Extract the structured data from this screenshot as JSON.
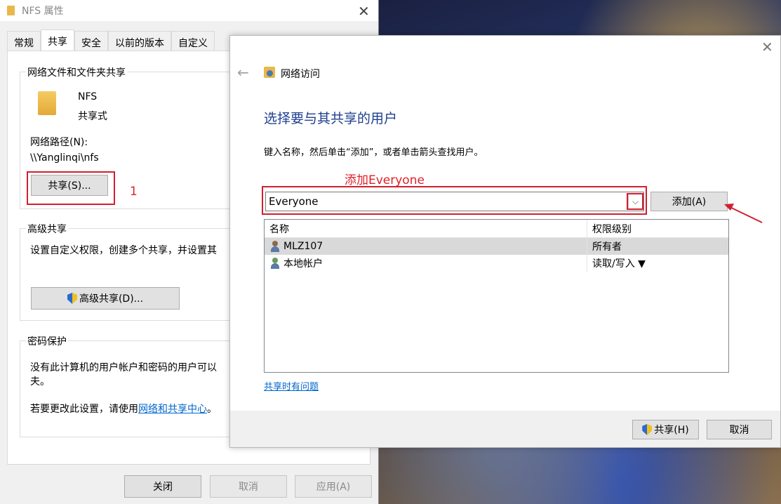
{
  "props_window": {
    "title": "NFS 属性",
    "tabs": [
      "常规",
      "共享",
      "安全",
      "以前的版本",
      "自定义"
    ],
    "network_share": {
      "group_title": "网络文件和文件夹共享",
      "folder_name": "NFS",
      "folder_status": "共享式",
      "path_label": "网络路径(N):",
      "path_value": "\\\\Yanglinqi\\nfs",
      "share_button": "共享(S)..."
    },
    "advanced": {
      "group_title": "高级共享",
      "description": "设置自定义权限，创建多个共享，并设置其",
      "button": "高级共享(D)..."
    },
    "password": {
      "group_title": "密码保护",
      "description_line1": "没有此计算机的用户帐户和密码的用户可以",
      "description_line2": "夫。",
      "change_prefix": "若要更改此设置，请使用",
      "change_link": "网络和共享中心",
      "change_suffix": "。"
    },
    "buttons": {
      "close": "关闭",
      "cancel": "取消",
      "apply": "应用(A)"
    }
  },
  "annotations": {
    "step1": "1",
    "add_everyone": "添加Everyone"
  },
  "dialog": {
    "nav_title": "网络访问",
    "heading": "选择要与其共享的用户",
    "instruction": "键入名称，然后单击“添加”，或者单击箭头查找用户。",
    "input_value": "Everyone",
    "add_button": "添加(A)",
    "columns": [
      "名称",
      "权限级别"
    ],
    "rows": [
      {
        "name": "MLZ107",
        "permission": "所有者",
        "icon": "user-icon"
      },
      {
        "name": "本地帐户",
        "permission": "读取/写入 ▼",
        "icon": "group-icon"
      }
    ],
    "help_link": "共享时有问题",
    "share_button": "共享(H)",
    "cancel_button": "取消"
  }
}
